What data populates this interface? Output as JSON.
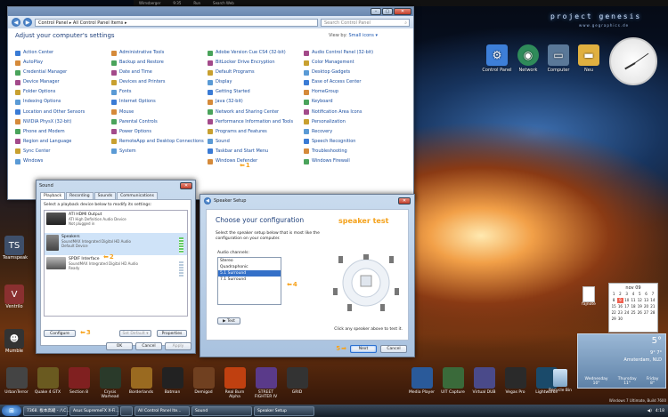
{
  "topbar": {
    "items": [
      "Wirnsberger",
      "9:35",
      "Run",
      "Search Web"
    ]
  },
  "brand": {
    "name": "project genesis",
    "url": "www.gegraphics.de"
  },
  "desktop_icons": [
    {
      "label": "Control Panel",
      "icon": "control-panel-icon",
      "color": "#3d7fd8"
    },
    {
      "label": "Network",
      "icon": "network-icon",
      "color": "#2f8b5a"
    },
    {
      "label": "Computer",
      "icon": "computer-icon",
      "color": "#5a7898"
    },
    {
      "label": "Neu",
      "icon": "folder-icon",
      "color": "#e0b040"
    }
  ],
  "left_icons": [
    {
      "label": "Teamspeak",
      "icon": "teamspeak-icon",
      "color": "#3e4f6a"
    },
    {
      "label": "Ventrilo",
      "icon": "ventrilo-icon",
      "color": "#8a3030"
    },
    {
      "label": "Mumble",
      "icon": "mumble-icon",
      "color": "#333"
    }
  ],
  "control_panel": {
    "address": "Control Panel  ▸  All Control Panel Items  ▸",
    "search_placeholder": "Search Control Panel",
    "heading": "Adjust your computer's settings",
    "view_by_label": "View by:",
    "view_by_value": "Small icons ▾",
    "columns": [
      [
        "Action Center",
        "AutoPlay",
        "Credential Manager",
        "Device Manager",
        "Folder Options",
        "Indexing Options",
        "Location and Other Sensors",
        "NVIDIA PhysX (32-bit)",
        "Phone and Modem",
        "Region and Language",
        "Sync Center",
        "Windows"
      ],
      [
        "Administrative Tools",
        "Backup and Restore",
        "Date and Time",
        "Devices and Printers",
        "Fonts",
        "Internet Options",
        "Mouse",
        "Parental Controls",
        "Power Options",
        "RemoteApp and Desktop Connections",
        "System"
      ],
      [
        "Adobe Version Cue CS4 (32-bit)",
        "BitLocker Drive Encryption",
        "Default Programs",
        "Display",
        "Getting Started",
        "Java (32-bit)",
        "Network and Sharing Center",
        "Performance Information and Tools",
        "Programs and Features",
        "Sound",
        "Taskbar and Start Menu",
        "Windows Defender"
      ],
      [
        "Audio Control Panel (32-bit)",
        "Color Management",
        "Desktop Gadgets",
        "Ease of Access Center",
        "HomeGroup",
        "Keyboard",
        "Notification Area Icons",
        "Personalization",
        "Recovery",
        "Speech Recognition",
        "Troubleshooting",
        "Windows Firewall"
      ]
    ],
    "sound_step": "1"
  },
  "sound_dialog": {
    "title": "Sound",
    "tabs": [
      "Playback",
      "Recording",
      "Sounds",
      "Communications"
    ],
    "hint": "Select a playback device below to modify its settings:",
    "devices": [
      {
        "name": "ATI HDMI Output",
        "sub1": "ATI High Definition Audio Device",
        "sub2": "Not plugged in"
      },
      {
        "name": "Speakers",
        "sub1": "SoundMAX Integrated Digital HD Audio",
        "sub2": "Default Device"
      },
      {
        "name": "SPDIF Interface",
        "sub1": "SoundMAX Integrated Digital HD Audio",
        "sub2": "Ready"
      }
    ],
    "configure": "Configure",
    "set_default": "Set Default ▾",
    "properties": "Properties",
    "ok": "OK",
    "cancel": "Cancel",
    "apply": "Apply",
    "step2": "2",
    "step3": "3"
  },
  "speaker_setup": {
    "title": "Speaker Setup",
    "heading": "Choose your configuration",
    "desc": "Select the speaker setup below that is most like the configuration on your computer.",
    "channels_label": "Audio channels:",
    "channels": [
      "Stereo",
      "Quadraphonic",
      "5.1 Surround",
      "7.1 Surround"
    ],
    "selected_channel": 2,
    "test": "▶ Test",
    "speaker_test_label": "speaker test",
    "click_hint": "Click any speaker above to test it.",
    "next": "Next",
    "cancel": "Cancel",
    "step4": "4",
    "step5": "5"
  },
  "calendar": {
    "month": "nov 09",
    "days": [
      "1",
      "2",
      "3",
      "4",
      "5",
      "6",
      "7",
      "8",
      "9",
      "10",
      "11",
      "12",
      "13",
      "14",
      "15",
      "16",
      "17",
      "18",
      "19",
      "20",
      "21",
      "22",
      "23",
      "24",
      "25",
      "26",
      "27",
      "28",
      "29",
      "30"
    ]
  },
  "weather": {
    "temp": "5°",
    "range": "9°  7°",
    "city": "Amsterdam, NLD",
    "days": [
      {
        "d": "Wednesday",
        "t": "10°"
      },
      {
        "d": "Thursday",
        "t": "11°"
      },
      {
        "d": "Friday",
        "t": "8°"
      }
    ],
    "src": "Foreca"
  },
  "note_icon": {
    "label": "fajnote"
  },
  "dock": [
    {
      "label": "UrbanTerror",
      "color": "#444"
    },
    {
      "label": "Quake 4 GTX",
      "color": "#6a5a20"
    },
    {
      "label": "Section 8",
      "color": "#802020"
    },
    {
      "label": "Crysis Warhead",
      "color": "#2a3a2a"
    },
    {
      "label": "Borderlands",
      "color": "#9a6a20"
    },
    {
      "label": "Batman",
      "color": "#222"
    },
    {
      "label": "Demigod",
      "color": "#704020"
    },
    {
      "label": "Real Burn Alpha",
      "color": "#c04010"
    },
    {
      "label": "STREET FIGHTER IV",
      "color": "#5a3a8a"
    },
    {
      "label": "GRID",
      "color": "#333"
    },
    {
      "label": "",
      "color": "transparent"
    },
    {
      "label": "",
      "color": "transparent"
    },
    {
      "label": "",
      "color": "transparent"
    },
    {
      "label": "Media Player",
      "color": "#2a5a9a"
    },
    {
      "label": "UIT Capture",
      "color": "#3a6a3a"
    },
    {
      "label": "Virtual DUB",
      "color": "#4a4a8a"
    },
    {
      "label": "Vegas Pro",
      "color": "#2a2a2a"
    },
    {
      "label": "Lightworks",
      "color": "#1a4a6a"
    }
  ],
  "recycle_bin": "Recycle Bin",
  "taskbar": {
    "items": [
      "7368. 板本高峻 - 八C...",
      "Asus SupremeFX X-Fi...",
      "",
      "All Control Panel Ite...",
      "Sound",
      "Speaker Setup"
    ],
    "time": "4:18",
    "build": "Windows 7 Ultimate, Build 7600"
  }
}
